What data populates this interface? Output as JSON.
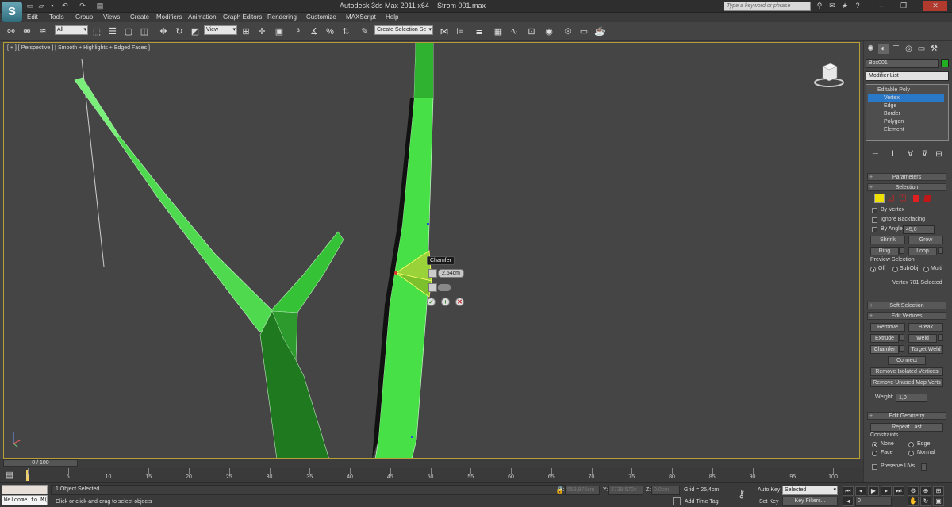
{
  "titlebar": {
    "title": "Autodesk 3ds Max  2011 x64",
    "filename": "Strom 001.max",
    "search_placeholder": "Type a keyword or phrase"
  },
  "menu": [
    "Edit",
    "Tools",
    "Group",
    "Views",
    "Create",
    "Modifiers",
    "Animation",
    "Graph Editors",
    "Rendering",
    "Customize",
    "MAXScript",
    "Help"
  ],
  "toolbar": {
    "selection_filter": "All",
    "ref_coord": "View",
    "named_selection": "Create Selection Se"
  },
  "viewport": {
    "label": "[ + ] [ Perspective ] [ Smooth + Highlights + Edged Faces ]"
  },
  "caddy": {
    "title": "Chamfer",
    "amount": "2,54cm",
    "ok_icon": "✓",
    "apply_icon": "+",
    "cancel_icon": "✕"
  },
  "command_panel": {
    "object_name": "Box001",
    "object_color": "#22b022",
    "modifier_list": "Modifier List",
    "stack": [
      "Editable Poly",
      "Vertex",
      "Edge",
      "Border",
      "Polygon",
      "Element"
    ],
    "parameters": "Parameters",
    "selection": {
      "title": "Selection",
      "by_vertex": "By Vertex",
      "ignore_backfacing": "Ignore Backfacing",
      "by_angle": "By Angle:",
      "angle_value": "45,0",
      "shrink": "Shrink",
      "grow": "Grow",
      "ring": "Ring",
      "loop": "Loop",
      "preview_title": "Preview Selection",
      "preview_off": "Off",
      "preview_subobj": "SubObj",
      "preview_multi": "Multi",
      "status": "Vertex 701 Selected"
    },
    "soft_selection": "Soft Selection",
    "edit_vertices": {
      "title": "Edit Vertices",
      "remove": "Remove",
      "break": "Break",
      "extrude": "Extrude",
      "weld": "Weld",
      "chamfer": "Chamfer",
      "target_weld": "Target Weld",
      "connect": "Connect",
      "remove_isolated": "Remove Isolated Vertices",
      "remove_unused": "Remove Unused Map Verts",
      "weight_label": "Weight:",
      "weight_value": "1,0"
    },
    "edit_geometry": {
      "title": "Edit Geometry",
      "repeat_last": "Repeat Last",
      "constraints": "Constraints",
      "none": "None",
      "edge": "Edge",
      "face": "Face",
      "normal": "Normal",
      "preserve_uvs": "Preserve UVs"
    }
  },
  "timeline": {
    "frame": "0 / 100",
    "ticks": [
      "0",
      "5",
      "10",
      "15",
      "20",
      "25",
      "30",
      "35",
      "40",
      "45",
      "50",
      "55",
      "60",
      "65",
      "70",
      "75",
      "80",
      "85",
      "90",
      "95",
      "100"
    ]
  },
  "status": {
    "listener": "Welcome to M(",
    "selected": "1 Object Selected",
    "prompt": "Click or click-and-drag to select objects",
    "x_label": "X:",
    "x_value": "559,875cm",
    "y_label": "Y:",
    "y_value": "2739,572c",
    "z_label": "Z:",
    "z_value": "0,0cm",
    "grid": "Grid = 25,4cm",
    "add_time_tag": "Add Time Tag",
    "auto_key": "Auto Key",
    "set_key": "Set Key",
    "key_mode": "Selected",
    "key_filters": "Key Filters...",
    "current_frame": "0"
  }
}
